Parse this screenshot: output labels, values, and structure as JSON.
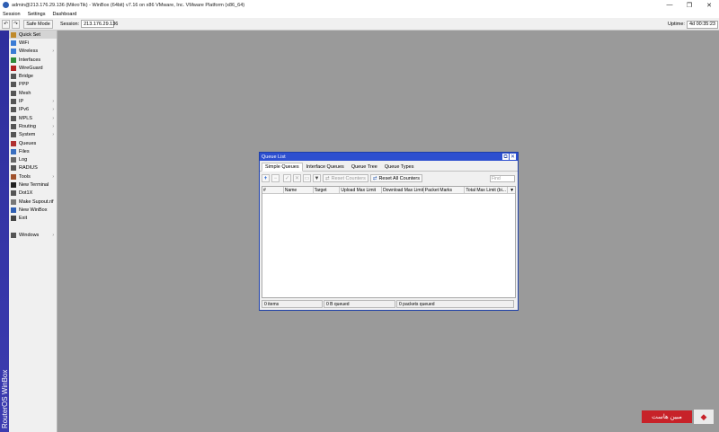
{
  "window": {
    "title": "admin@213.176.29.136 (MikroTik) - WinBox (64bit) v7.16 on x86 VMware, Inc. VMware Platform (x86_64)",
    "controls": {
      "minimize": "—",
      "maximize": "❐",
      "close": "✕"
    }
  },
  "menubar": [
    "Session",
    "Settings",
    "Dashboard"
  ],
  "toolbar": {
    "undo_icon": "↶",
    "redo_icon": "↷",
    "safe_mode": "Safe Mode",
    "session_label": "Session:",
    "session_value": "213.176.29.136",
    "uptime_label": "Uptime:",
    "uptime_value": "4d 00:35:23"
  },
  "sidebar": {
    "vertical_brand": "RouterOS WinBox",
    "items": [
      {
        "label": "Quick Set",
        "icon": "quick-set-icon",
        "color": "#c08a2a",
        "arrow": false,
        "selected": true
      },
      {
        "label": "WiFi",
        "icon": "wifi-icon",
        "color": "#3a7bd5",
        "arrow": false
      },
      {
        "label": "Wireless",
        "icon": "wireless-icon",
        "color": "#3a7bd5",
        "arrow": true
      },
      {
        "label": "Interfaces",
        "icon": "interfaces-icon",
        "color": "#2e8b3a",
        "arrow": false
      },
      {
        "label": "WireGuard",
        "icon": "wireguard-icon",
        "color": "#b22222",
        "arrow": false
      },
      {
        "label": "Bridge",
        "icon": "bridge-icon",
        "color": "#555555",
        "arrow": false
      },
      {
        "label": "PPP",
        "icon": "ppp-icon",
        "color": "#555555",
        "arrow": false
      },
      {
        "label": "Mesh",
        "icon": "mesh-icon",
        "color": "#555555",
        "arrow": false
      },
      {
        "label": "IP",
        "icon": "ip-icon",
        "color": "#555555",
        "arrow": true
      },
      {
        "label": "IPv6",
        "icon": "ipv6-icon",
        "color": "#555555",
        "arrow": true
      },
      {
        "label": "MPLS",
        "icon": "mpls-icon",
        "color": "#555555",
        "arrow": true
      },
      {
        "label": "Routing",
        "icon": "routing-icon",
        "color": "#555555",
        "arrow": true
      },
      {
        "label": "System",
        "icon": "system-icon",
        "color": "#555555",
        "arrow": true
      },
      {
        "label": "Queues",
        "icon": "queues-icon",
        "color": "#b03030",
        "arrow": false
      },
      {
        "label": "Files",
        "icon": "files-icon",
        "color": "#3a6fc0",
        "arrow": false
      },
      {
        "label": "Log",
        "icon": "log-icon",
        "color": "#666666",
        "arrow": false
      },
      {
        "label": "RADIUS",
        "icon": "radius-icon",
        "color": "#555555",
        "arrow": false
      },
      {
        "label": "Tools",
        "icon": "tools-icon",
        "color": "#a0522d",
        "arrow": true
      },
      {
        "label": "New Terminal",
        "icon": "terminal-icon",
        "color": "#222222",
        "arrow": false
      },
      {
        "label": "Dot1X",
        "icon": "dot1x-icon",
        "color": "#555555",
        "arrow": false
      },
      {
        "label": "Make Supout.rif",
        "icon": "supout-icon",
        "color": "#777777",
        "arrow": false
      },
      {
        "label": "New WinBox",
        "icon": "winbox-icon",
        "color": "#2f5fb3",
        "arrow": false
      },
      {
        "label": "Exit",
        "icon": "exit-icon",
        "color": "#444444",
        "arrow": false
      },
      {
        "label": "",
        "spacer": true
      },
      {
        "label": "Windows",
        "icon": "windows-icon",
        "color": "#555555",
        "arrow": true
      }
    ]
  },
  "queue_window": {
    "title": "Queue List",
    "restore_icon": "⧉",
    "close_icon": "✕",
    "tabs": [
      "Simple Queues",
      "Interface Queues",
      "Queue Tree",
      "Queue Types"
    ],
    "active_tab": 0,
    "toolbar": {
      "add_icon": "+",
      "remove_icon": "−",
      "enable_icon": "✓",
      "disable_icon": "✕",
      "comment_icon": "▭",
      "filter_icon": "▼",
      "reset_counters": "Reset Counters",
      "reset_all_counters": "Reset All Counters",
      "find_placeholder": "Find"
    },
    "columns": [
      "#",
      "Name",
      "Target",
      "Upload Max Limit",
      "Download Max Limit",
      "Packet Marks",
      "Total Max Limit (bi..."
    ],
    "column_menu_icon": "▼",
    "rows": [],
    "status": [
      "0 items",
      "0 B queued",
      "0 packets queued"
    ]
  },
  "watermark": {
    "text": "مبین هاست",
    "icon": "hosting-logo-icon"
  }
}
